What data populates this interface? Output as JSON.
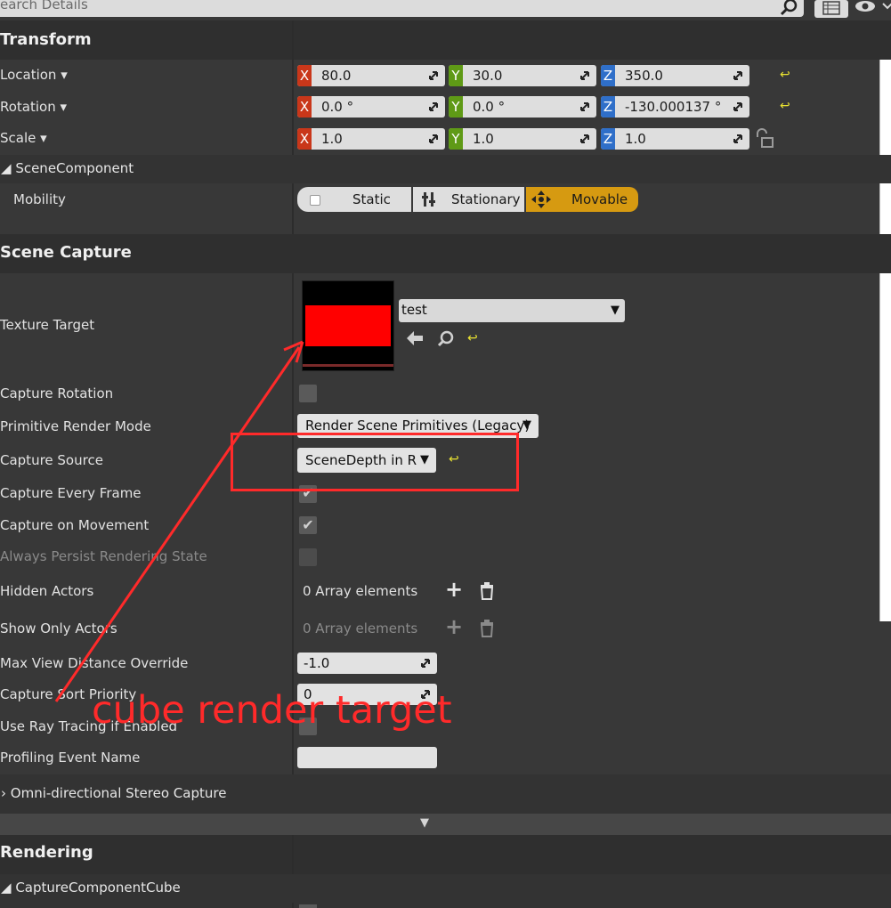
{
  "search": {
    "placeholder": "earch Details"
  },
  "sections": {
    "transform": "Transform",
    "scene_component": "SceneComponent",
    "scene_capture": "Scene Capture",
    "omni": "Omni-directional Stereo Capture",
    "rendering": "Rendering",
    "capture_cube": "CaptureComponentCube"
  },
  "transform": {
    "location": {
      "label": "Location",
      "x": "80.0",
      "y": "30.0",
      "z": "350.0"
    },
    "rotation": {
      "label": "Rotation",
      "x": "0.0 °",
      "y": "0.0 °",
      "z": "-130.000137 °"
    },
    "scale": {
      "label": "Scale",
      "x": "1.0",
      "y": "1.0",
      "z": "1.0"
    },
    "axes": {
      "x": "X",
      "y": "Y",
      "z": "Z"
    }
  },
  "mobility": {
    "label": "Mobility",
    "options": [
      "Static",
      "Stationary",
      "Movable"
    ],
    "selected": "Movable"
  },
  "capture": {
    "texture_target": {
      "label": "Texture Target",
      "asset": "test"
    },
    "capture_rotation": "Capture Rotation",
    "primitive_render_mode": {
      "label": "Primitive Render Mode",
      "value": "Render Scene Primitives (Legacy)"
    },
    "capture_source": {
      "label": "Capture Source",
      "value": "SceneDepth in R"
    },
    "capture_every_frame": "Capture Every Frame",
    "capture_on_movement": "Capture on Movement",
    "always_persist": "Always Persist Rendering State",
    "hidden_actors": {
      "label": "Hidden Actors",
      "value": "0 Array elements"
    },
    "show_only_actors": {
      "label": "Show Only Actors",
      "value": "0 Array elements"
    },
    "max_view_distance": {
      "label": "Max View Distance Override",
      "value": "-1.0"
    },
    "capture_sort_priority": {
      "label": "Capture Sort Priority",
      "value": "0"
    },
    "use_ray_tracing": "Use Ray Tracing if Enabled",
    "profiling_event_name": {
      "label": "Profiling Event Name",
      "value": ""
    }
  },
  "annotation": "cube render target",
  "colors": {
    "accent": "#d69a11",
    "annotation": "#ff2a2a",
    "reset": "#e9e232"
  }
}
